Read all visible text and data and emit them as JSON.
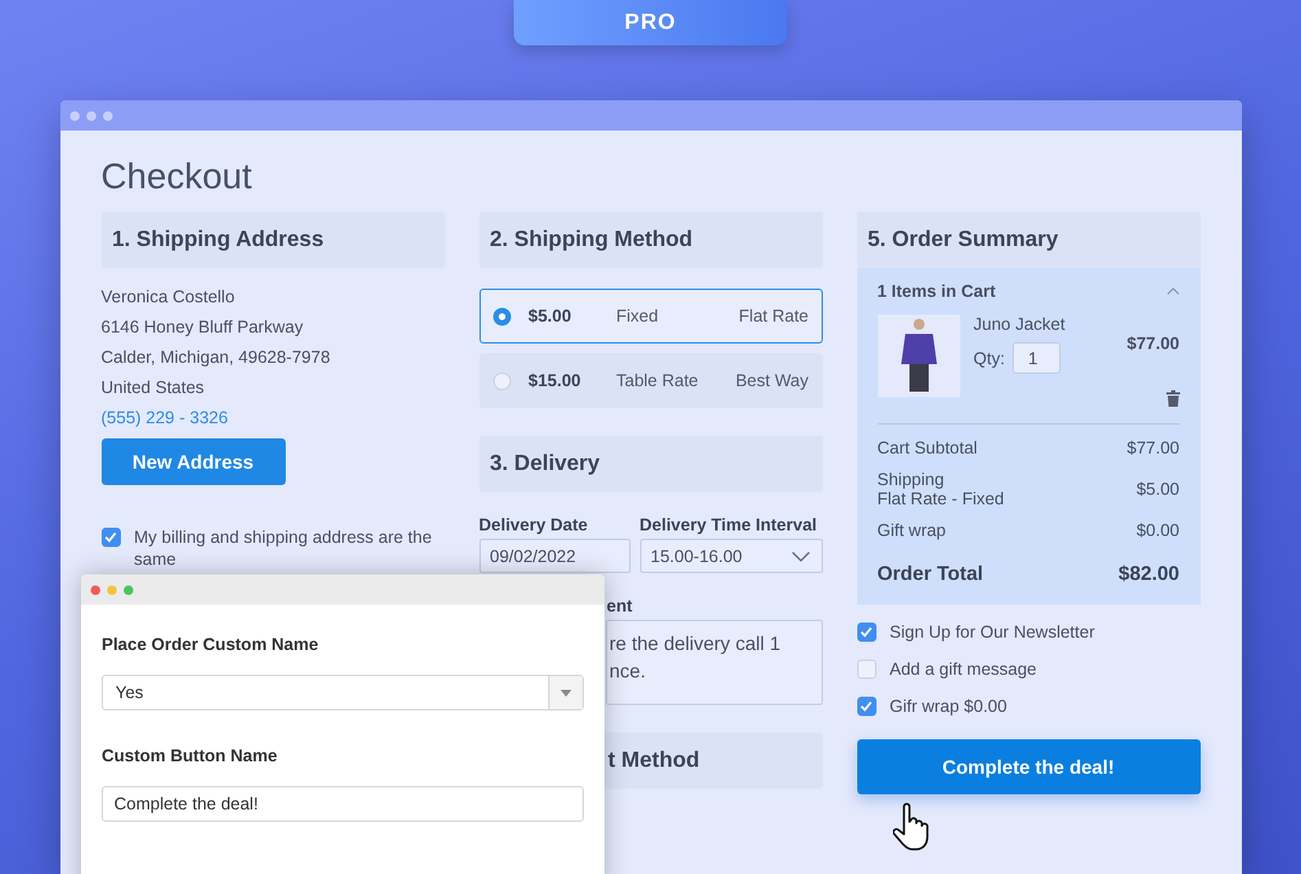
{
  "badge": "PRO",
  "page_title": "Checkout",
  "shipping_address": {
    "heading": "1. Shipping Address",
    "lines": [
      "Veronica Costello",
      "6146 Honey Bluff Parkway",
      "Calder, Michigan, 49628-7978",
      "United States"
    ],
    "phone": "(555) 229 - 3326",
    "new_address_button": "New Address",
    "same_address": {
      "label": "My billing and shipping address are the same",
      "checked": true
    }
  },
  "shipping_method": {
    "heading": "2. Shipping Method",
    "options": [
      {
        "price": "$5.00",
        "method": "Fixed",
        "carrier": "Flat Rate",
        "selected": true
      },
      {
        "price": "$15.00",
        "method": "Table Rate",
        "carrier": "Best Way",
        "selected": false
      }
    ]
  },
  "delivery": {
    "heading": "3. Delivery",
    "date_label": "Delivery Date",
    "date_value": "09/02/2022",
    "interval_label": "Delivery Time Interval",
    "interval_value": "15.00-16.00",
    "comment_label": "ent",
    "comment_value": "re the delivery call 1\nnce."
  },
  "payment_heading": "t Method",
  "order_summary": {
    "heading": "5. Order Summary",
    "cart_label": "1 Items in Cart",
    "expanded": true,
    "item": {
      "name": "Juno Jacket",
      "qty_label": "Qty:",
      "qty": "1",
      "price": "$77.00"
    },
    "totals": [
      {
        "label": "Cart Subtotal",
        "value": "$77.00"
      },
      {
        "label": "Shipping",
        "sublabel": "Flat Rate - Fixed",
        "value": "$5.00"
      },
      {
        "label": "Gift wrap",
        "value": "$0.00"
      }
    ],
    "order_total": {
      "label": "Order Total",
      "value": "$82.00"
    }
  },
  "options": [
    {
      "label": "Sign Up for Our Newsletter",
      "checked": true
    },
    {
      "label": "Add a gift message",
      "checked": false
    },
    {
      "label": "Gifr wrap $0.00",
      "checked": true
    }
  ],
  "place_order_button": "Complete the deal!",
  "settings_window": {
    "fields": [
      {
        "kind": "select",
        "label": "Place Order Custom Name",
        "value": "Yes"
      },
      {
        "kind": "text",
        "label": "Custom Button Name",
        "value": "Complete the deal!"
      }
    ]
  }
}
